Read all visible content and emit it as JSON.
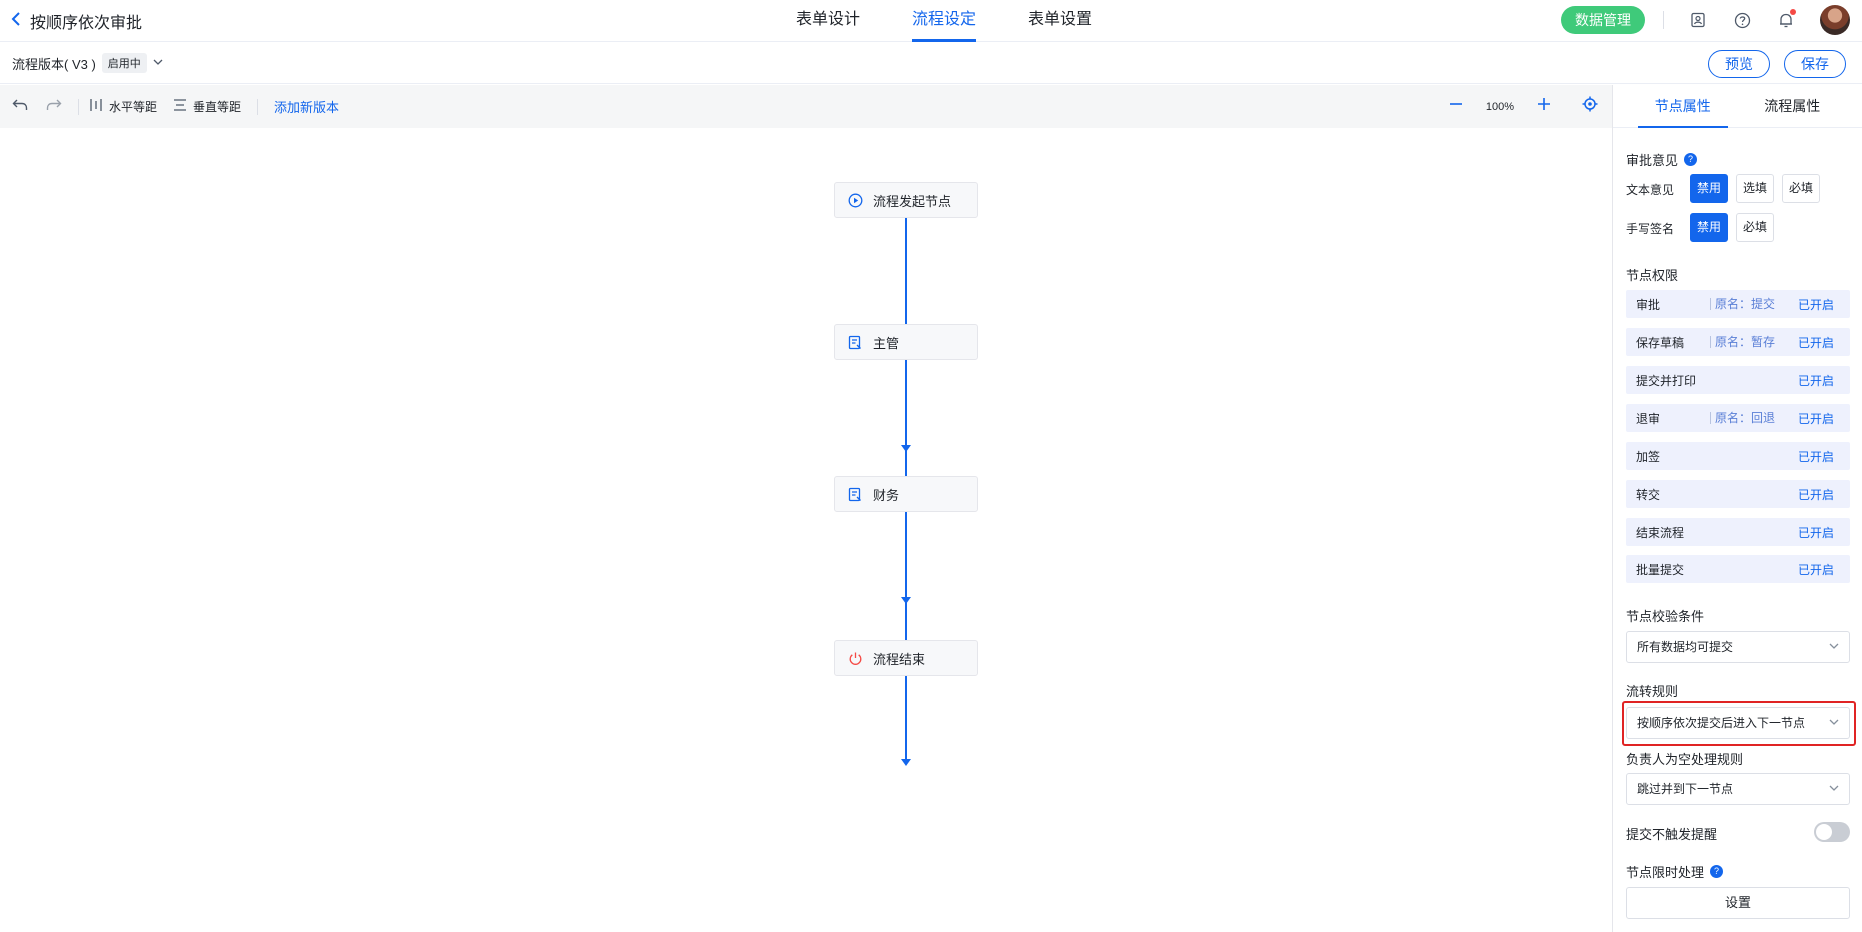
{
  "header": {
    "back_title": "按顺序依次审批",
    "tabs": [
      {
        "label": "表单设计"
      },
      {
        "label": "流程设定"
      },
      {
        "label": "表单设置"
      }
    ],
    "data_manage": "数据管理"
  },
  "version_bar": {
    "version": "流程版本( V3 )",
    "status_badge": "启用中",
    "preview": "预览",
    "save": "保存"
  },
  "canvas_toolbar": {
    "h_spacing": "水平等距",
    "v_spacing": "垂直等距",
    "add_version": "添加新版本",
    "zoom": "100%"
  },
  "flow": {
    "nodes": [
      {
        "label": "流程发起节点",
        "icon": "play-circle-icon"
      },
      {
        "label": "主管",
        "icon": "approval-form-icon"
      },
      {
        "label": "财务",
        "icon": "approval-form-icon"
      },
      {
        "label": "流程结束",
        "icon": "power-icon"
      }
    ]
  },
  "panel": {
    "tabs": [
      {
        "label": "节点属性"
      },
      {
        "label": "流程属性"
      }
    ],
    "approval_opinion": {
      "title": "审批意见",
      "text_opinion_label": "文本意见",
      "text_options": [
        "禁用",
        "选填",
        "必填"
      ],
      "signature_label": "手写签名",
      "signature_options": [
        "禁用",
        "必填"
      ]
    },
    "permissions": {
      "title": "节点权限",
      "items": [
        {
          "name": "审批",
          "orig": "原名：提交",
          "state": "已开启"
        },
        {
          "name": "保存草稿",
          "orig": "原名：暂存",
          "state": "已开启"
        },
        {
          "name": "提交并打印",
          "orig": "",
          "state": "已开启"
        },
        {
          "name": "退审",
          "orig": "原名：回退",
          "state": "已开启"
        },
        {
          "name": "加签",
          "orig": "",
          "state": "已开启"
        },
        {
          "name": "转交",
          "orig": "",
          "state": "已开启"
        },
        {
          "name": "结束流程",
          "orig": "",
          "state": "已开启"
        },
        {
          "name": "批量提交",
          "orig": "",
          "state": "已开启"
        }
      ]
    },
    "validation": {
      "title": "节点校验条件",
      "value": "所有数据均可提交"
    },
    "flow_rule": {
      "title": "流转规则",
      "value": "按顺序依次提交后进入下一节点"
    },
    "empty_rule": {
      "title": "负责人为空处理规则",
      "value": "跳过并到下一节点"
    },
    "no_remind": {
      "title": "提交不触发提醒"
    },
    "time_limit": {
      "title": "节点限时处理",
      "button": "设置"
    }
  },
  "colors": {
    "accent": "#1366ec",
    "data_button": "#3fca7a",
    "highlight": "#e02424"
  }
}
